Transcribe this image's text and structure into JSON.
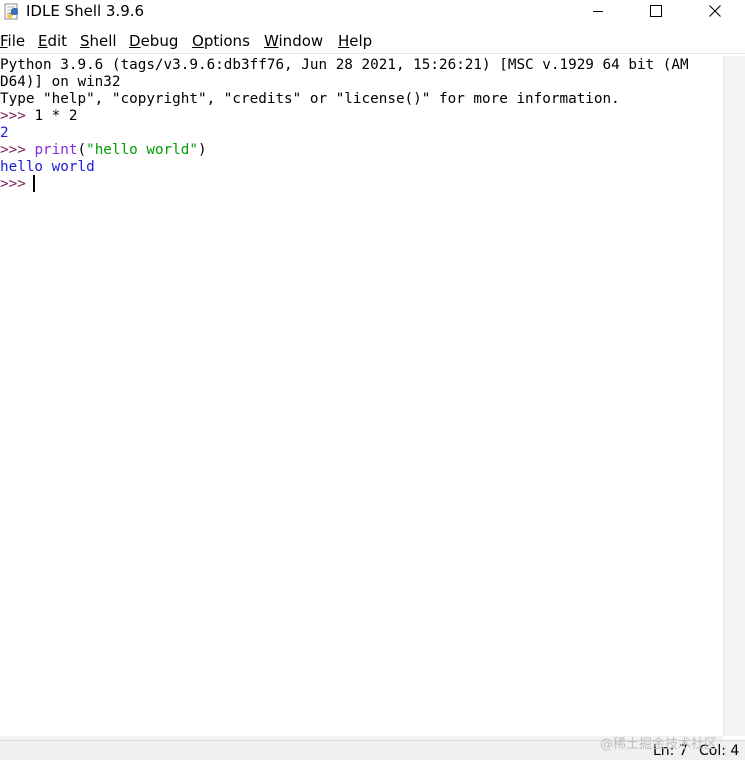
{
  "window": {
    "title": "IDLE Shell 3.9.6",
    "minimize_glyph": "—",
    "maximize_glyph": "☐",
    "close_glyph": "✕"
  },
  "menu": {
    "file": {
      "u": "F",
      "rest": "ile"
    },
    "edit": {
      "u": "E",
      "rest": "dit"
    },
    "shell": {
      "u": "S",
      "rest": "hell"
    },
    "debug": {
      "u": "D",
      "rest": "ebug"
    },
    "options": {
      "u": "O",
      "rest": "ptions"
    },
    "window": {
      "u": "W",
      "rest": "indow"
    },
    "help": {
      "u": "H",
      "rest": "elp"
    }
  },
  "shell": {
    "banner_line1": "Python 3.9.6 (tags/v3.9.6:db3ff76, Jun 28 2021, 15:26:21) [MSC v.1929 64 bit (AM",
    "banner_line2": "D64)] on win32",
    "banner_line3": "Type \"help\", \"copyright\", \"credits\" or \"license()\" for more information.",
    "prompt": ">>> ",
    "cmd1": "1 * 2",
    "out1": "2",
    "cmd2_func": "print",
    "cmd2_open": "(",
    "cmd2_string": "\"hello world\"",
    "cmd2_close": ")",
    "out2": "hello world"
  },
  "status": {
    "line": "Ln: 7",
    "col": "Col: 4",
    "watermark": "@稀土掘金技术社区"
  },
  "colors": {
    "prompt": "#7a1f5a",
    "stdout": "#1b1bd6",
    "builtin": "#8a2be2",
    "string": "#00a000"
  }
}
